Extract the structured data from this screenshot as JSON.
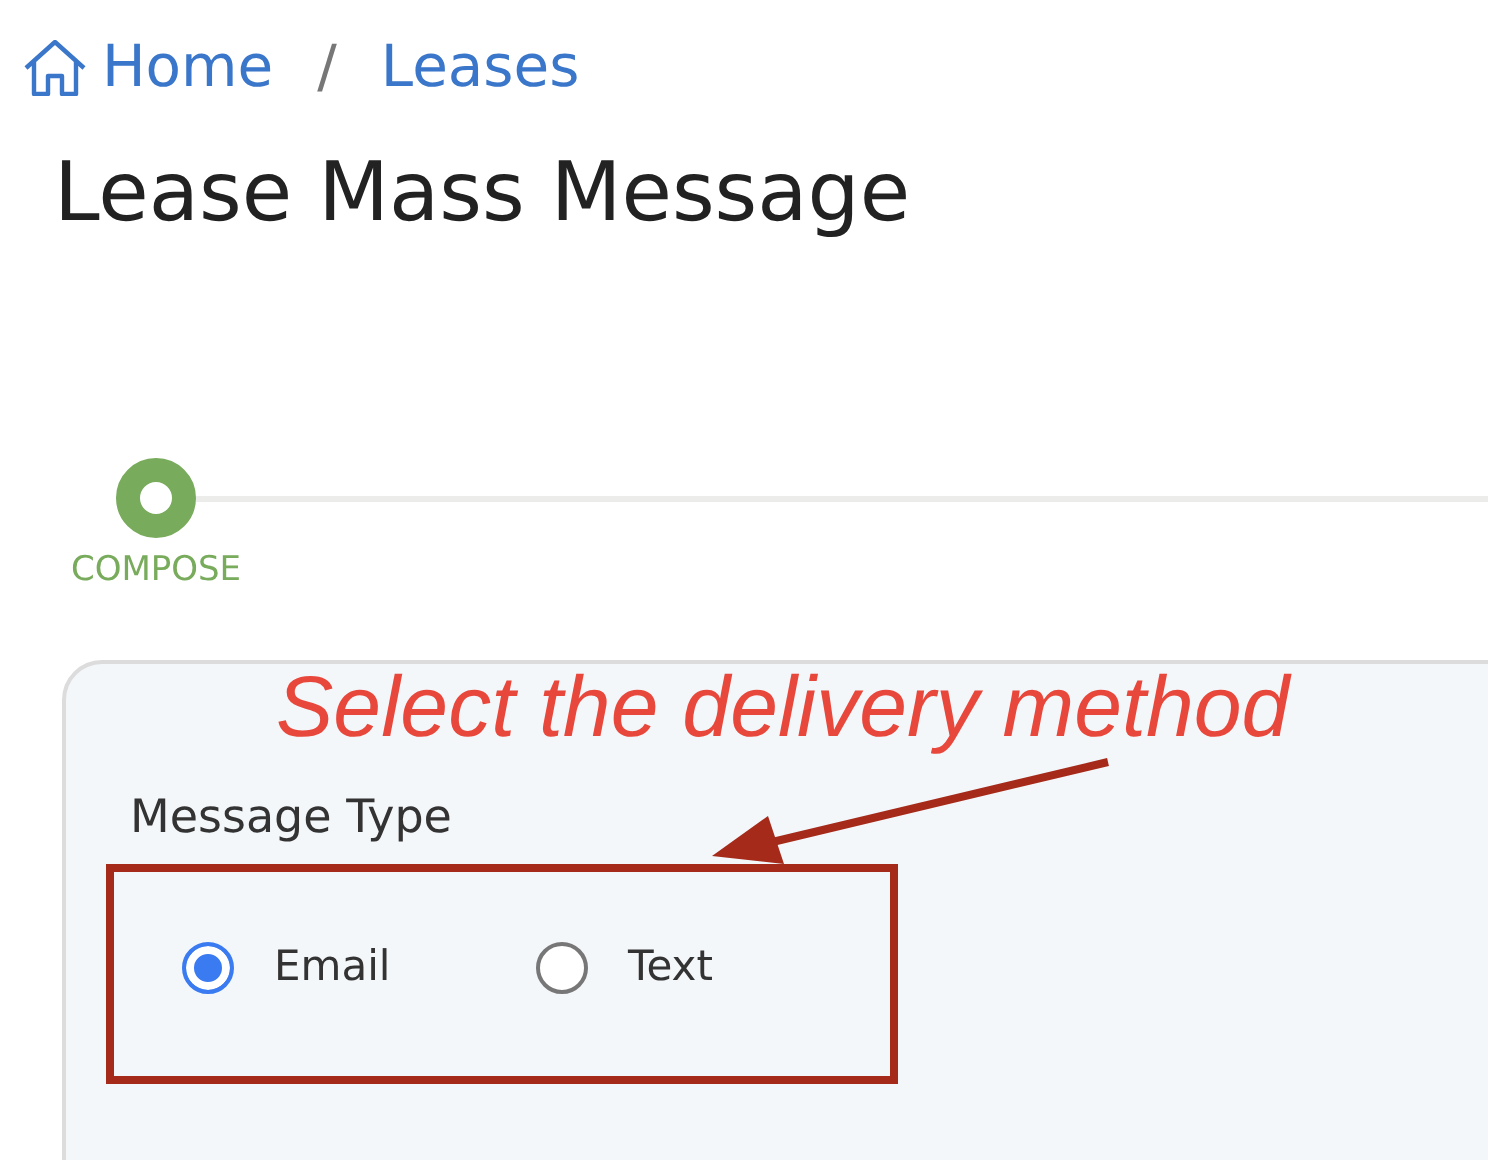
{
  "breadcrumb": [
    {
      "label": "Home",
      "kind": "home"
    },
    {
      "label": "Leases",
      "kind": "link"
    }
  ],
  "breadcrumb_separator": "/",
  "page_title": "Lease Mass Message",
  "steps": [
    {
      "label": "COMPOSE",
      "selected": true
    }
  ],
  "message_type": {
    "label": "Message Type",
    "options": [
      {
        "label": "Email",
        "selected": true
      },
      {
        "label": "Text",
        "selected": false
      }
    ]
  },
  "annotation": {
    "text": "Select the delivery method"
  }
}
